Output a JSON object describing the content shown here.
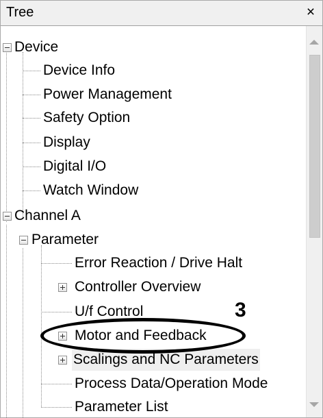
{
  "window": {
    "title": "Tree",
    "close_glyph": "×"
  },
  "tree": {
    "device": {
      "label": "Device",
      "children": [
        "Device Info",
        "Power Management",
        "Safety Option",
        "Display",
        "Digital I/O",
        "Watch Window"
      ]
    },
    "channel_a": {
      "label": "Channel A",
      "parameter": {
        "label": "Parameter",
        "children": [
          "Error Reaction / Drive Halt",
          "Controller Overview",
          "U/f Control",
          "Motor and Feedback",
          "Scalings and NC Parameters",
          "Process Data/Operation Mode",
          "Parameter List"
        ]
      }
    },
    "selected_item": "Scalings and NC Parameters"
  },
  "annotation": {
    "label": "3",
    "highlighted_item": "Motor and Feedback"
  },
  "icons": {
    "expand": "plus-box-icon",
    "collapse": "minus-box-icon",
    "close": "close-icon"
  }
}
